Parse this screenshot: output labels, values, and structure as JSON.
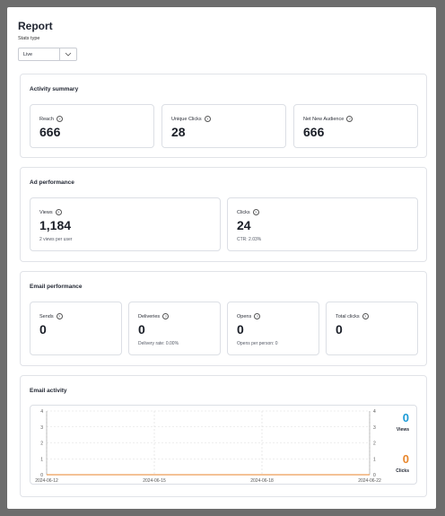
{
  "header": {
    "title": "Report",
    "stats_type_label": "Stats type",
    "stats_type_value": "Live"
  },
  "activity_summary": {
    "title": "Activity summary",
    "cards": [
      {
        "label": "Reach",
        "value": "666"
      },
      {
        "label": "Unique Clicks",
        "value": "28"
      },
      {
        "label": "Net New Audience",
        "value": "666"
      }
    ]
  },
  "ad_performance": {
    "title": "Ad performance",
    "cards": [
      {
        "label": "Views",
        "value": "1,184",
        "sub": "2 views per user"
      },
      {
        "label": "Clicks",
        "value": "24",
        "sub": "CTR: 2.03%"
      }
    ]
  },
  "email_performance": {
    "title": "Email performance",
    "cards": [
      {
        "label": "Sends",
        "value": "0",
        "sub": ""
      },
      {
        "label": "Deliveries",
        "value": "0",
        "sub": "Delivery rate: 0.00%"
      },
      {
        "label": "Opens",
        "value": "0",
        "sub": "Opens per person: 0"
      },
      {
        "label": "Total clicks",
        "value": "0",
        "sub": ""
      }
    ]
  },
  "email_activity": {
    "title": "Email activity",
    "legend": [
      {
        "value": "0",
        "label": "Views",
        "color": "#1b9bd7"
      },
      {
        "value": "0",
        "label": "Clicks",
        "color": "#e8862c"
      }
    ]
  },
  "chart_data": {
    "type": "line",
    "x": [
      "2024-06-12",
      "2024-06-15",
      "2024-06-18",
      "2024-06-22"
    ],
    "series": [
      {
        "name": "Views",
        "values": [
          0,
          0,
          0,
          0
        ],
        "color": "#1b9bd7"
      },
      {
        "name": "Clicks",
        "values": [
          0,
          0,
          0,
          0
        ],
        "color": "#e8862c"
      }
    ],
    "ylim": [
      0,
      4
    ],
    "yticks": [
      "0",
      "1",
      "2",
      "3",
      "4"
    ],
    "grid": true
  }
}
